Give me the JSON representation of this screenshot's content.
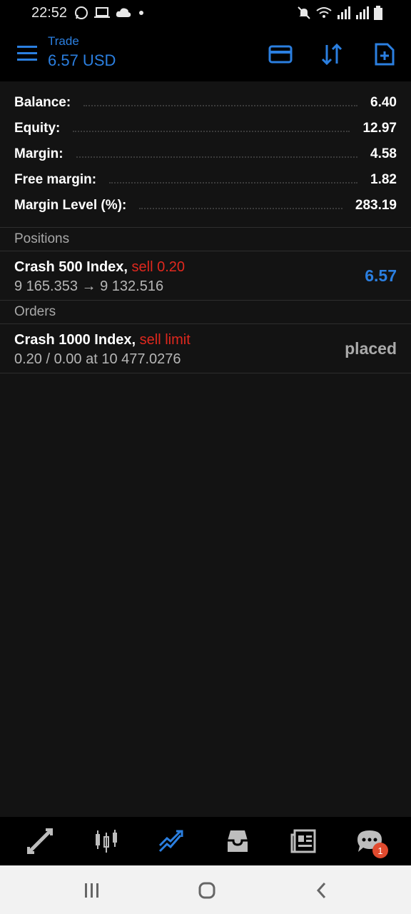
{
  "status_bar": {
    "time": "22:52"
  },
  "header": {
    "title": "Trade",
    "subtitle": "6.57 USD"
  },
  "summary": [
    {
      "label": "Balance:",
      "value": "6.40"
    },
    {
      "label": "Equity:",
      "value": "12.97"
    },
    {
      "label": "Margin:",
      "value": "4.58"
    },
    {
      "label": "Free margin:",
      "value": "1.82"
    },
    {
      "label": "Margin Level (%):",
      "value": "283.19"
    }
  ],
  "positions": {
    "header": "Positions",
    "items": [
      {
        "symbol": "Crash 500 Index,",
        "side": "sell 0.20",
        "prices": "9 165.353 → 9 132.516",
        "profit": "6.57"
      }
    ]
  },
  "orders": {
    "header": "Orders",
    "items": [
      {
        "symbol": "Crash 1000 Index,",
        "side": "sell limit",
        "details": "0.20 / 0.00 at 10 477.0276",
        "state": "placed"
      }
    ]
  },
  "bottom_nav": {
    "items": [
      "quotes-icon",
      "chart-icon",
      "trade-icon",
      "history-icon",
      "news-icon",
      "chat-icon"
    ],
    "chat_badge": "1"
  },
  "colors": {
    "accent": "#2b7fe0",
    "sell": "#e0281e",
    "background": "#131313"
  }
}
